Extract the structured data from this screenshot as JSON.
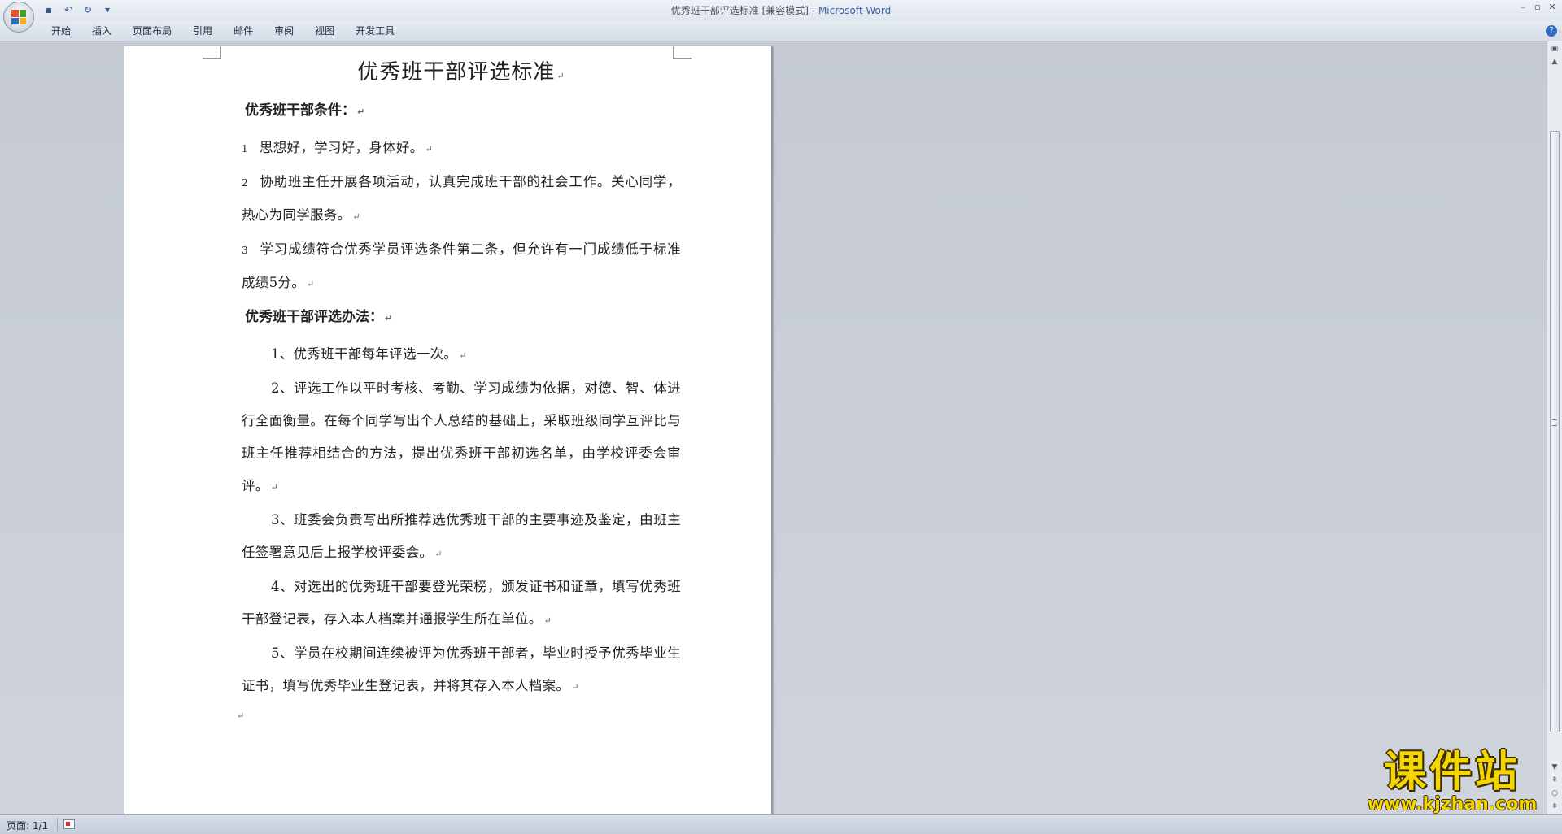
{
  "window": {
    "title": "优秀班干部评选标准 [兼容模式]",
    "app_name": "Microsoft Word",
    "separator": " - "
  },
  "quick_access": [
    {
      "name": "save-icon",
      "glyph": "▪"
    },
    {
      "name": "undo-icon",
      "glyph": "↶"
    },
    {
      "name": "redo-icon",
      "glyph": "↻"
    },
    {
      "name": "customize-icon",
      "glyph": "▾"
    }
  ],
  "tabs": [
    {
      "label": "开始"
    },
    {
      "label": "插入"
    },
    {
      "label": "页面布局"
    },
    {
      "label": "引用"
    },
    {
      "label": "邮件"
    },
    {
      "label": "审阅"
    },
    {
      "label": "视图"
    },
    {
      "label": "开发工具"
    }
  ],
  "document": {
    "title": "优秀班干部评选标准",
    "section1_heading": "优秀班干部条件：",
    "conditions": [
      {
        "num": "1",
        "text": "思想好，学习好，身体好。"
      },
      {
        "num": "2",
        "text": "协助班主任开展各项活动，认真完成班干部的社会工作。关心同学，热心为同学服务。"
      },
      {
        "num": "3",
        "text": "学习成绩符合优秀学员评选条件第二条，但允许有一门成绩低于标准成绩5分。"
      }
    ],
    "section2_heading": "优秀班干部评选办法：",
    "methods": [
      "1、优秀班干部每年评选一次。",
      "2、评选工作以平时考核、考勤、学习成绩为依据，对德、智、体进行全面衡量。在每个同学写出个人总结的基础上，采取班级同学互评比与班主任推荐相结合的方法，提出优秀班干部初选名单，由学校评委会审评。",
      "3、班委会负责写出所推荐选优秀班干部的主要事迹及鉴定，由班主任签署意见后上报学校评委会。",
      "4、对选出的优秀班干部要登光荣榜，颁发证书和证章，填写优秀班干部登记表，存入本人档案并通报学生所在单位。",
      "5、学员在校期间连续被评为优秀班干部者，毕业时授予优秀毕业生证书，填写优秀毕业生登记表，并将其存入本人档案。"
    ],
    "para_mark": "↵"
  },
  "status": {
    "page": "页面: 1/1"
  },
  "watermark": {
    "cn": "课件站",
    "url": "www.kjzhan.com"
  },
  "colors": {
    "workspace": "#c9ced7",
    "accent": "#3b63a8",
    "watermark": "#f3d500"
  }
}
